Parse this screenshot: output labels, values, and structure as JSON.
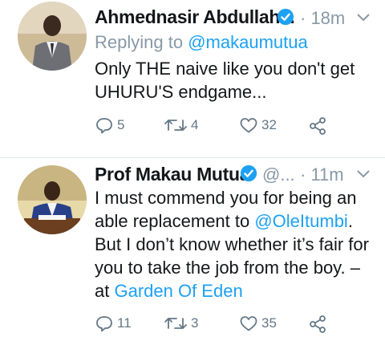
{
  "tweets": [
    {
      "display_name": "Ahmednasir Abdullah...",
      "handle": "",
      "time": "· 18m",
      "reply_prefix": "Replying to",
      "reply_to": "@makaumutua",
      "text": "Only THE naive like you don't get UHURU'S endgame...",
      "replies": "5",
      "retweets": "4",
      "likes": "32"
    },
    {
      "display_name": "Prof Makau Mutua",
      "handle": "@...",
      "time": "· 11m",
      "text_before": "I must commend you for being an able replacement to ",
      "mention": "@OleItumbi",
      "text_after": ". But I don’t know whether it’s fair for you to take the job from the boy. – at ",
      "place": "Garden Of Eden",
      "replies": "11",
      "retweets": "3",
      "likes": "35"
    }
  ],
  "colors": {
    "accent": "#1da1f2",
    "muted": "#8899a6",
    "text": "#14171a",
    "divider": "#e1e8ed"
  },
  "icons": [
    "verified-badge-icon",
    "chevron-down-icon",
    "reply-icon",
    "retweet-icon",
    "like-icon",
    "share-icon"
  ]
}
